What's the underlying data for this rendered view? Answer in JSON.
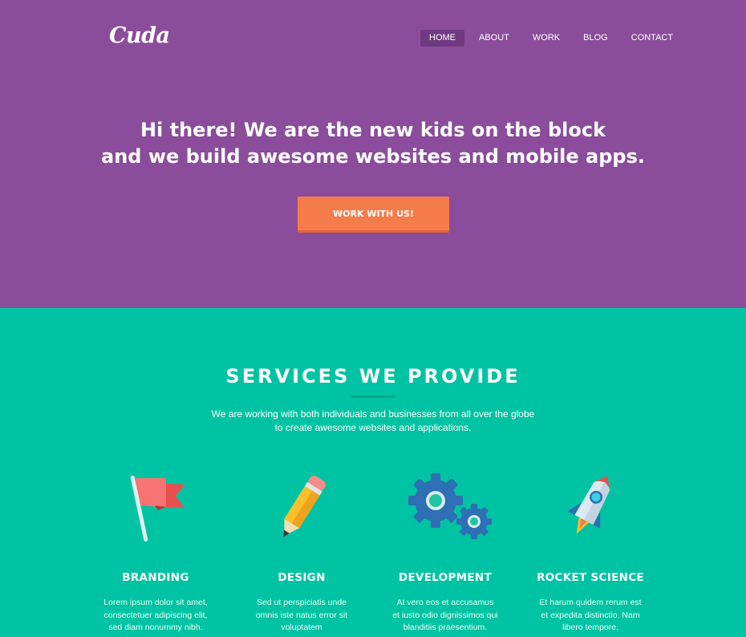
{
  "brand": {
    "logo": "Cuda"
  },
  "nav": {
    "items": [
      {
        "label": "HOME"
      },
      {
        "label": "ABOUT"
      },
      {
        "label": "WORK"
      },
      {
        "label": "BLOG"
      },
      {
        "label": "CONTACT"
      }
    ],
    "active": "HOME"
  },
  "hero": {
    "line1": "Hi there! We are the new kids on the block",
    "line2": "and we build awesome websites and mobile apps.",
    "cta_label": "WORK WITH US!"
  },
  "services": {
    "title": "SERVICES WE PROVIDE",
    "intro_line1": "We are working with both individuals and businesses from all over the globe",
    "intro_line2": "to create awesome websites and applications.",
    "items": [
      {
        "title": "BRANDING",
        "icon": "flag-icon",
        "text": "Lorem ipsum dolor sit amet, consectetuer adipiscing elit, sed diam nonummy nibh."
      },
      {
        "title": "DESIGN",
        "icon": "pencil-icon",
        "text": "Sed ut perspiciatis unde omnis iste natus error sit voluptatem"
      },
      {
        "title": "DEVELOPMENT",
        "icon": "gears-icon",
        "text": "At vero eos et accusamus et iusto odio dignissimos qui blanditiis praesentium."
      },
      {
        "title": "ROCKET SCIENCE",
        "icon": "rocket-icon",
        "text": "Et harum quidem rerum est et expedita distinctio. Nam libero tempore."
      }
    ]
  },
  "colors": {
    "hero_bg": "#8b4d9b",
    "nav_active_bg": "#6f3a80",
    "cta_bg": "#f47c4a",
    "services_bg": "#00c3a3"
  }
}
